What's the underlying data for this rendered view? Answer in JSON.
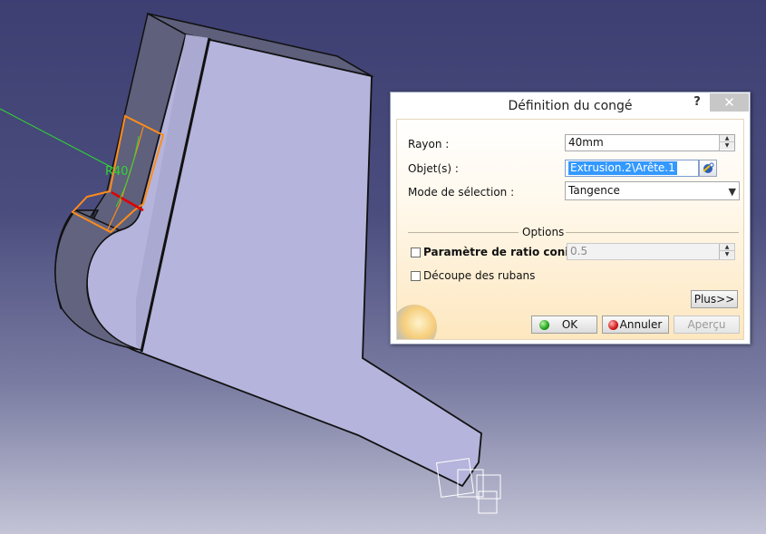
{
  "dialog": {
    "title": "Définition du congé",
    "help_label": "?",
    "close_label": "✕",
    "fields": {
      "radius_label": "Rayon :",
      "radius_value": "40mm",
      "objects_label": "Objet(s) :",
      "objects_value": "Extrusion.2\\Arête.1",
      "mode_label": "Mode de sélection :",
      "mode_value": "Tangence"
    },
    "options": {
      "title": "Options",
      "conic_label": "Paramètre de ratio conique :",
      "conic_value": "0.5",
      "conic_checked": false,
      "ribbon_label": "Découpe des rubans",
      "ribbon_checked": false
    },
    "buttons": {
      "more": "Plus>>",
      "ok": "OK",
      "cancel": "Annuler",
      "preview": "Aperçu"
    }
  },
  "viewport": {
    "dimension_label": "R40",
    "part_color": "#b4b4dc",
    "highlight_color": "#ff8c1a",
    "edge_color": "#e00000",
    "dimension_color": "#2fd62f"
  }
}
